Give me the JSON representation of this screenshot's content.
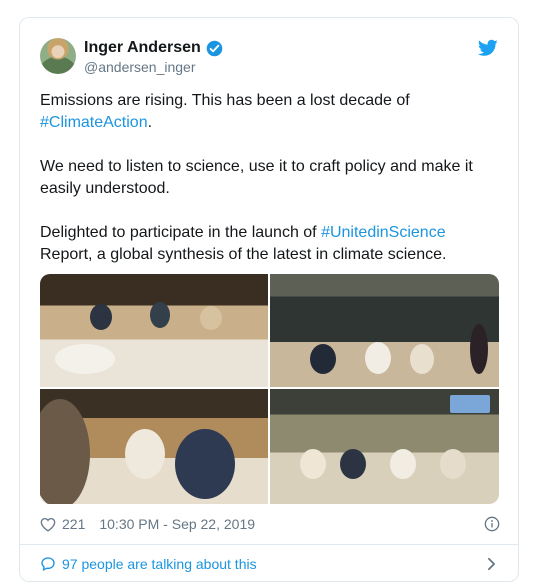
{
  "tweet": {
    "author": {
      "name": "Inger Andersen",
      "handle": "@andersen_inger",
      "verified": true
    },
    "paragraphs": [
      {
        "before": "Emissions are rising. This has been a lost decade of ",
        "hashtag": "#ClimateAction",
        "after": "."
      },
      {
        "text": "We need to listen to science, use it to craft policy and make it easily understood."
      },
      {
        "before": "Delighted to participate in the launch of ",
        "hashtag": "#UnitedinScience",
        "after": " Report, a global synthesis of the latest in climate science."
      }
    ],
    "photos": [
      {
        "name": "photo-conference-room-left"
      },
      {
        "name": "photo-conference-room-right"
      },
      {
        "name": "photo-panel-speakers"
      },
      {
        "name": "photo-panel-wide"
      }
    ],
    "likes": "221",
    "timestamp": "10:30 PM - Sep 22, 2019",
    "talking_label": "97 people are talking about this"
  },
  "icons": {
    "brand": "twitter-bird-icon",
    "verified": "verified-badge-icon",
    "like": "heart-icon",
    "info": "info-icon",
    "comments": "speech-bubble-icon",
    "more": "chevron-right-icon"
  },
  "colors": {
    "accent": "#1b95e0",
    "text": "#14171a",
    "muted": "#657786",
    "border": "#e1e8ed"
  }
}
